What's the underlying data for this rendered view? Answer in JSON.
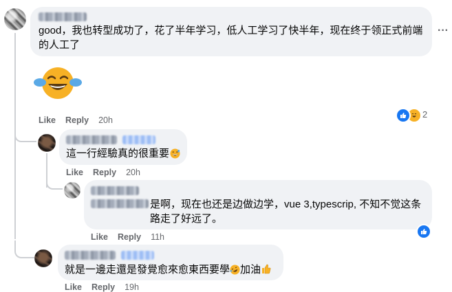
{
  "comments": [
    {
      "text": "good，我也转型成功了，花了半年学习，低人工学习了快半年，现在终于领正式前端的人工了",
      "like_label": "Like",
      "reply_label": "Reply",
      "time": "20h",
      "reaction_count": "2",
      "more_label": "···"
    },
    {
      "text": "這一行經驗真的很重要",
      "like_label": "Like",
      "reply_label": "Reply",
      "time": "20h"
    },
    {
      "text": "是啊，现在也还是边做边学，vue 3,typescrip, 不知不觉这条路走了好远了。",
      "like_label": "Like",
      "reply_label": "Reply",
      "time": "11h"
    },
    {
      "text": "就是一邊走還是發覺愈來愈東西要學",
      "text_tail": "加油",
      "like_label": "Like",
      "reply_label": "Reply",
      "time": "19h"
    }
  ],
  "icons": {
    "like_color": "#1877f2",
    "haha_color": "#f7b125"
  }
}
